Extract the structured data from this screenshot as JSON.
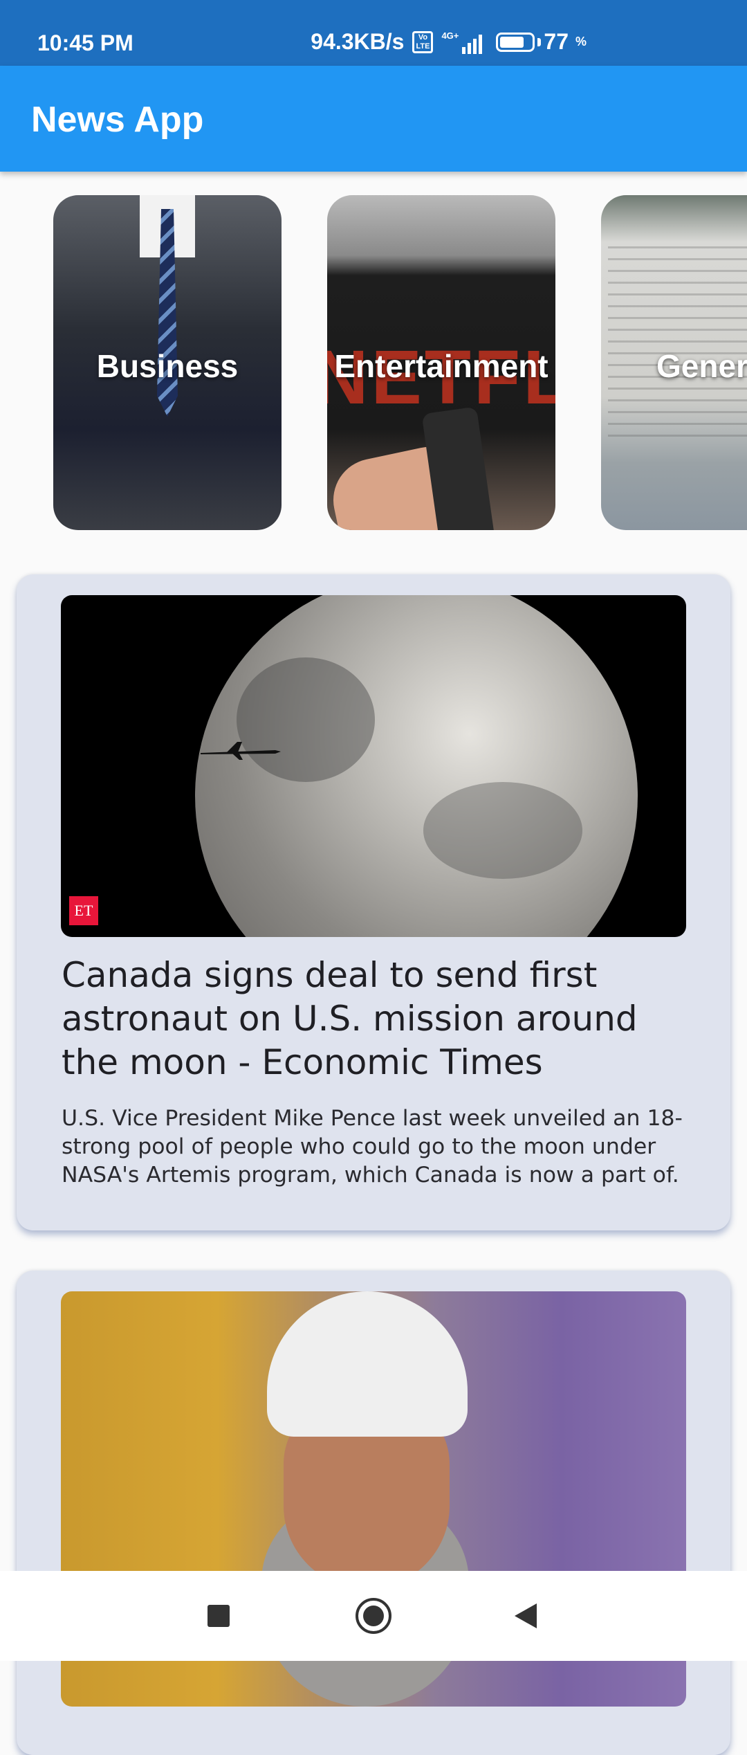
{
  "status_bar": {
    "time": "10:45 PM",
    "network_speed": "94.3KB/s",
    "volte_label": "Vo\nLTE",
    "network_type": "4G+",
    "battery_percent": "77",
    "battery_symbol": "%",
    "battery_level": 0.77
  },
  "app_bar": {
    "title": "News App",
    "color": "#2196f3"
  },
  "categories": [
    {
      "label": "Business"
    },
    {
      "label": "Entertainment"
    },
    {
      "label": "Gener"
    }
  ],
  "articles": [
    {
      "title": "Canada signs deal to send first astronaut on U.S. mission around the moon - Economic Times",
      "description": "U.S. Vice President Mike Pence last week unveiled an 18-strong pool of people who could go to the moon under NASA's Artemis program, which Canada is now a part of.",
      "image_badge": "ET"
    },
    {
      "title": "",
      "description": ""
    }
  ],
  "nav_bar": {
    "recents_icon": "square-icon",
    "home_icon": "circle-icon",
    "back_icon": "triangle-icon"
  }
}
